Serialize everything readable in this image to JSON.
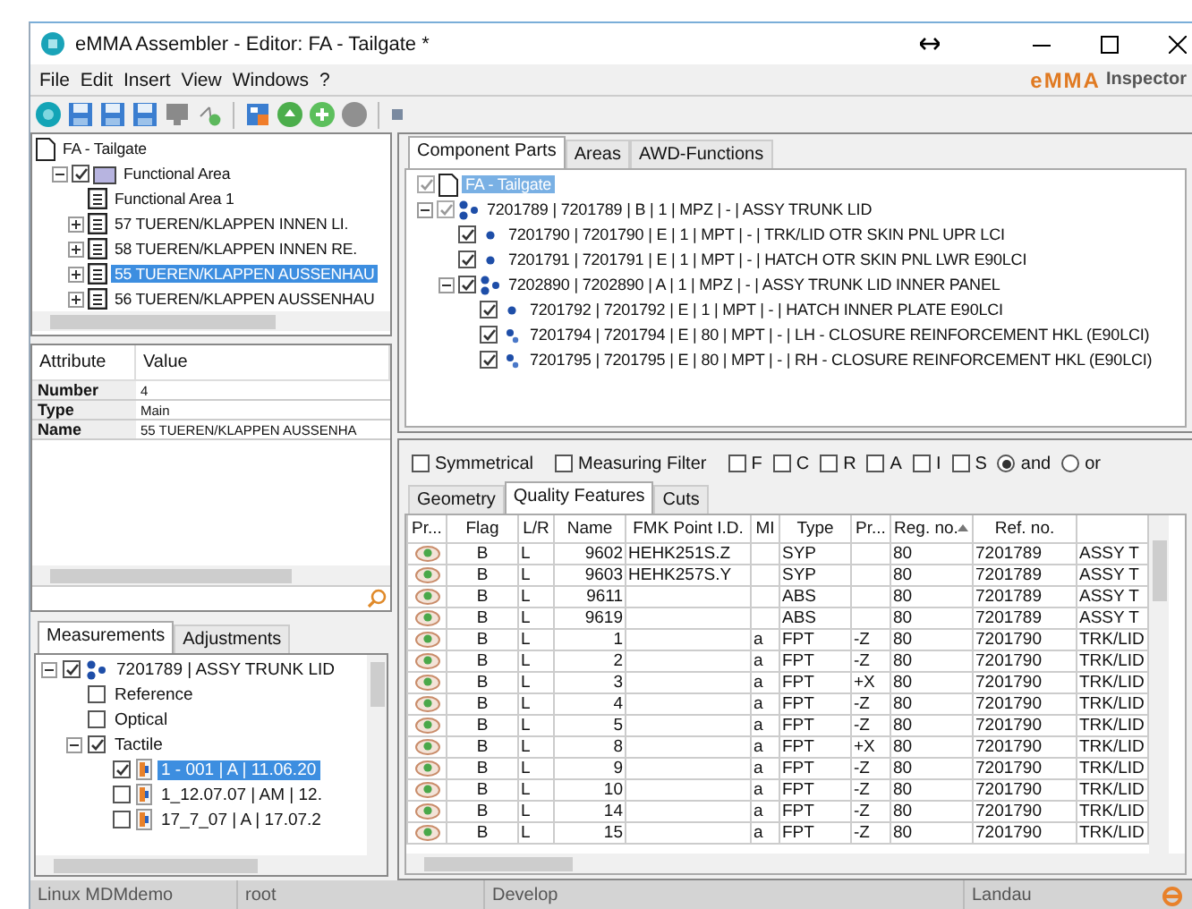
{
  "window": {
    "title": "eMMA Assembler - Editor: FA - Tailgate *"
  },
  "menu": [
    "File",
    "Edit",
    "Insert",
    "View",
    "Windows",
    "?"
  ],
  "brand": {
    "logo": "eMMA",
    "name": "Inspector"
  },
  "area_tree": [
    {
      "label": "FA - Tailgate",
      "kind": "document",
      "selected": false,
      "children": [
        {
          "label": "Functional Area",
          "kind": "folder",
          "checked": true,
          "expanded": true,
          "selected": false,
          "children": [
            {
              "label": "Functional Area 1",
              "kind": "sheet",
              "selected": false
            },
            {
              "label": "57 TUEREN/KLAPPEN INNEN LI.",
              "kind": "sheet",
              "expanded": false,
              "selected": false
            },
            {
              "label": "58 TUEREN/KLAPPEN INNEN RE.",
              "kind": "sheet",
              "expanded": false,
              "selected": false
            },
            {
              "label": "55 TUEREN/KLAPPEN AUSSENHAU",
              "kind": "sheet",
              "expanded": false,
              "selected": true
            },
            {
              "label": "56 TUEREN/KLAPPEN AUSSENHAU",
              "kind": "sheet",
              "expanded": false,
              "selected": false
            }
          ]
        }
      ]
    }
  ],
  "attributes": {
    "columns": [
      "Attribute",
      "Value"
    ],
    "rows": [
      {
        "attribute": "Number",
        "value": "4"
      },
      {
        "attribute": "Type",
        "value": "Main"
      },
      {
        "attribute": "Name",
        "value": "55 TUEREN/KLAPPEN AUSSENHA"
      }
    ]
  },
  "measurement_tabs": [
    {
      "label": "Measurements",
      "selected": true
    },
    {
      "label": "Adjustments",
      "selected": false
    }
  ],
  "measurement_tree": [
    {
      "label": "7201789 | ASSY TRUNK LID",
      "kind": "assembly",
      "checked": true,
      "expanded": true,
      "selected": false,
      "children": [
        {
          "label": "Reference",
          "checked": false,
          "selected": false
        },
        {
          "label": "Optical",
          "checked": false,
          "selected": false
        },
        {
          "label": "Tactile",
          "checked": true,
          "expanded": true,
          "selected": false,
          "children": [
            {
              "label": "1 - 001 | A | 11.06.20",
              "kind": "measurement",
              "checked": true,
              "selected": true
            },
            {
              "label": "1_12.07.07 | AM | 12.",
              "kind": "measurement",
              "checked": false,
              "selected": false
            },
            {
              "label": "17_7_07 | A | 17.07.2",
              "kind": "measurement",
              "checked": false,
              "selected": false
            }
          ]
        }
      ]
    }
  ],
  "component_tabs": [
    {
      "label": "Component Parts",
      "selected": true
    },
    {
      "label": "Areas",
      "selected": false
    },
    {
      "label": "AWD-Functions",
      "selected": false
    }
  ],
  "component_tree": [
    {
      "label": "FA - Tailgate",
      "kind": "document",
      "checked": true,
      "disabled": true,
      "selected": true
    },
    {
      "label": "7201789 | 7201789 | B | 1 | MPZ | - | ASSY TRUNK LID",
      "kind": "assembly",
      "checked": true,
      "disabled": true,
      "expanded": true,
      "selected": false,
      "children": [
        {
          "label": "7201790 | 7201790 | E | 1 | MPT | - | TRK/LID OTR SKIN PNL UPR LCI",
          "kind": "part",
          "checked": true,
          "disabled": false,
          "selected": false
        },
        {
          "label": "7201791 | 7201791 | E | 1 | MPT | - | HATCH OTR SKIN PNL LWR E90LCI",
          "kind": "part",
          "checked": true,
          "disabled": false,
          "selected": false
        },
        {
          "label": "7202890 | 7202890 | A | 1 | MPZ | - | ASSY TRUNK LID INNER PANEL",
          "kind": "assembly",
          "checked": true,
          "disabled": false,
          "expanded": true,
          "selected": false,
          "children": [
            {
              "label": "7201792 | 7201792 | E | 1 | MPT | - | HATCH INNER PLATE E90LCI",
              "kind": "part",
              "checked": true,
              "disabled": false,
              "selected": false
            },
            {
              "label": "7201794 | 7201794 | E | 80 | MPT | - | LH - CLOSURE REINFORCEMENT HKL (E90LCI)",
              "kind": "subpart",
              "checked": true,
              "disabled": false,
              "selected": false
            },
            {
              "label": "7201795 | 7201795 | E | 80 | MPT | - | RH - CLOSURE REINFORCEMENT HKL (E90LCI)",
              "kind": "subpart",
              "checked": true,
              "disabled": false,
              "selected": false
            }
          ]
        }
      ]
    }
  ],
  "filters": [
    {
      "label": "Symmetrical",
      "kind": "checkbox",
      "checked": false
    },
    {
      "label": "Measuring Filter",
      "kind": "checkbox",
      "checked": false
    },
    {
      "label": "F",
      "kind": "checkbox",
      "checked": false
    },
    {
      "label": "C",
      "kind": "checkbox",
      "checked": false
    },
    {
      "label": "R",
      "kind": "checkbox",
      "checked": false
    },
    {
      "label": "A",
      "kind": "checkbox",
      "checked": false
    },
    {
      "label": "I",
      "kind": "checkbox",
      "checked": false
    },
    {
      "label": "S",
      "kind": "checkbox",
      "checked": false
    },
    {
      "label": "and",
      "kind": "radio",
      "checked": true
    },
    {
      "label": "or",
      "kind": "radio",
      "checked": false
    }
  ],
  "feature_tabs": [
    {
      "label": "Geometry",
      "selected": false
    },
    {
      "label": "Quality Features",
      "selected": true
    },
    {
      "label": "Cuts",
      "selected": false
    }
  ],
  "table": {
    "columns": [
      "Pr...",
      "Flag",
      "L/R",
      "Name",
      "FMK Point I.D.",
      "MI",
      "Type",
      "Pr...",
      "Reg. no.",
      "Ref. no.",
      ""
    ],
    "rows": [
      [
        "",
        "B",
        "L",
        "9602",
        "HEHK251S.Z",
        "",
        "SYP",
        "",
        "80",
        "7201789",
        "ASSY T"
      ],
      [
        "",
        "B",
        "L",
        "9603",
        "HEHK257S.Y",
        "",
        "SYP",
        "",
        "80",
        "7201789",
        "ASSY T"
      ],
      [
        "",
        "B",
        "L",
        "9611",
        "",
        "",
        "ABS",
        "",
        "80",
        "7201789",
        "ASSY T"
      ],
      [
        "",
        "B",
        "L",
        "9619",
        "",
        "",
        "ABS",
        "",
        "80",
        "7201789",
        "ASSY T"
      ],
      [
        "",
        "B",
        "L",
        "1",
        "",
        "a",
        "FPT",
        "-Z",
        "80",
        "7201790",
        "TRK/LID"
      ],
      [
        "",
        "B",
        "L",
        "2",
        "",
        "a",
        "FPT",
        "-Z",
        "80",
        "7201790",
        "TRK/LID"
      ],
      [
        "",
        "B",
        "L",
        "3",
        "",
        "a",
        "FPT",
        "+X",
        "80",
        "7201790",
        "TRK/LID"
      ],
      [
        "",
        "B",
        "L",
        "4",
        "",
        "a",
        "FPT",
        "-Z",
        "80",
        "7201790",
        "TRK/LID"
      ],
      [
        "",
        "B",
        "L",
        "5",
        "",
        "a",
        "FPT",
        "-Z",
        "80",
        "7201790",
        "TRK/LID"
      ],
      [
        "",
        "B",
        "L",
        "8",
        "",
        "a",
        "FPT",
        "+X",
        "80",
        "7201790",
        "TRK/LID"
      ],
      [
        "",
        "B",
        "L",
        "9",
        "",
        "a",
        "FPT",
        "-Z",
        "80",
        "7201790",
        "TRK/LID"
      ],
      [
        "",
        "B",
        "L",
        "10",
        "",
        "a",
        "FPT",
        "-Z",
        "80",
        "7201790",
        "TRK/LID"
      ],
      [
        "",
        "B",
        "L",
        "14",
        "",
        "a",
        "FPT",
        "-Z",
        "80",
        "7201790",
        "TRK/LID"
      ],
      [
        "",
        "B",
        "L",
        "15",
        "",
        "a",
        "FPT",
        "-Z",
        "80",
        "7201790",
        "TRK/LID"
      ]
    ]
  },
  "status_bar": [
    "Linux MDMdemo",
    "root",
    "Develop",
    "Landau"
  ]
}
